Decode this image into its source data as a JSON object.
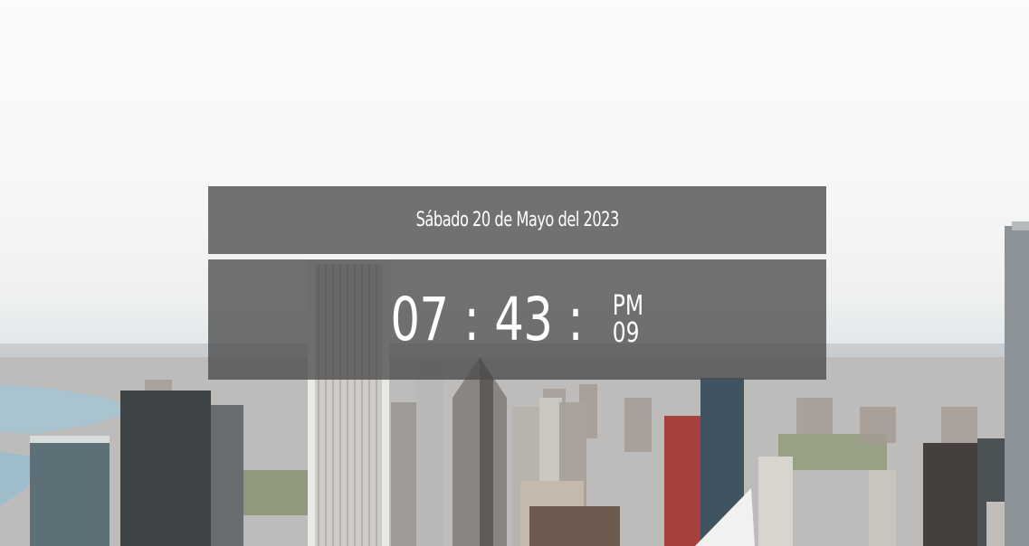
{
  "clock": {
    "date": "Sábado 20 de Mayo del 2023",
    "hours": "07",
    "minutes": "43",
    "separator": ":",
    "meridiem": "PM",
    "seconds": "09"
  },
  "background": {
    "subject": "city-skyline-photo",
    "panel_color": "#4b4b4b",
    "text_color": "#ffffff"
  }
}
